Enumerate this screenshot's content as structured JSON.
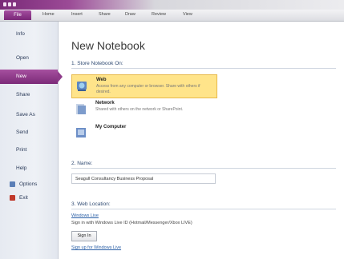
{
  "ribbon": {
    "file_tab": "File",
    "tabs": [
      "Home",
      "Insert",
      "Share",
      "Draw",
      "Review",
      "View"
    ]
  },
  "sidebar": {
    "items": [
      {
        "label": "Info"
      },
      {
        "label": "Open"
      },
      {
        "label": "New",
        "selected": true
      },
      {
        "label": "Share"
      },
      {
        "label": "Save As"
      },
      {
        "label": "Send"
      },
      {
        "label": "Print"
      },
      {
        "label": "Help"
      },
      {
        "label": "Options",
        "icon": "options-icon"
      },
      {
        "label": "Exit",
        "icon": "exit-icon"
      }
    ]
  },
  "main": {
    "title": "New Notebook",
    "section1": "1. Store Notebook On:",
    "store_options": [
      {
        "title": "Web",
        "desc": "Access from any computer or browser. Share with others if desired.",
        "selected": true,
        "icon": "globe-icon"
      },
      {
        "title": "Network",
        "desc": "Shared with others on the network or SharePoint.",
        "selected": false,
        "icon": "network-icon"
      },
      {
        "title": "My Computer",
        "desc": "",
        "selected": false,
        "icon": "computer-icon"
      }
    ],
    "section2": "2. Name:",
    "name_value": "Seagull Consultancy Business Proposal",
    "section3": "3. Web Location:",
    "wl_link": "Windows Live",
    "signin_text": "Sign in with Windows Live ID (Hotmail/Messenger/Xbox LIVE)",
    "signin_button": "Sign In",
    "signup_link": "Sign up for Windows Live"
  },
  "colors": {
    "accent": "#7b2a78",
    "selection": "#ffe48a",
    "link": "#2a5fa6"
  }
}
